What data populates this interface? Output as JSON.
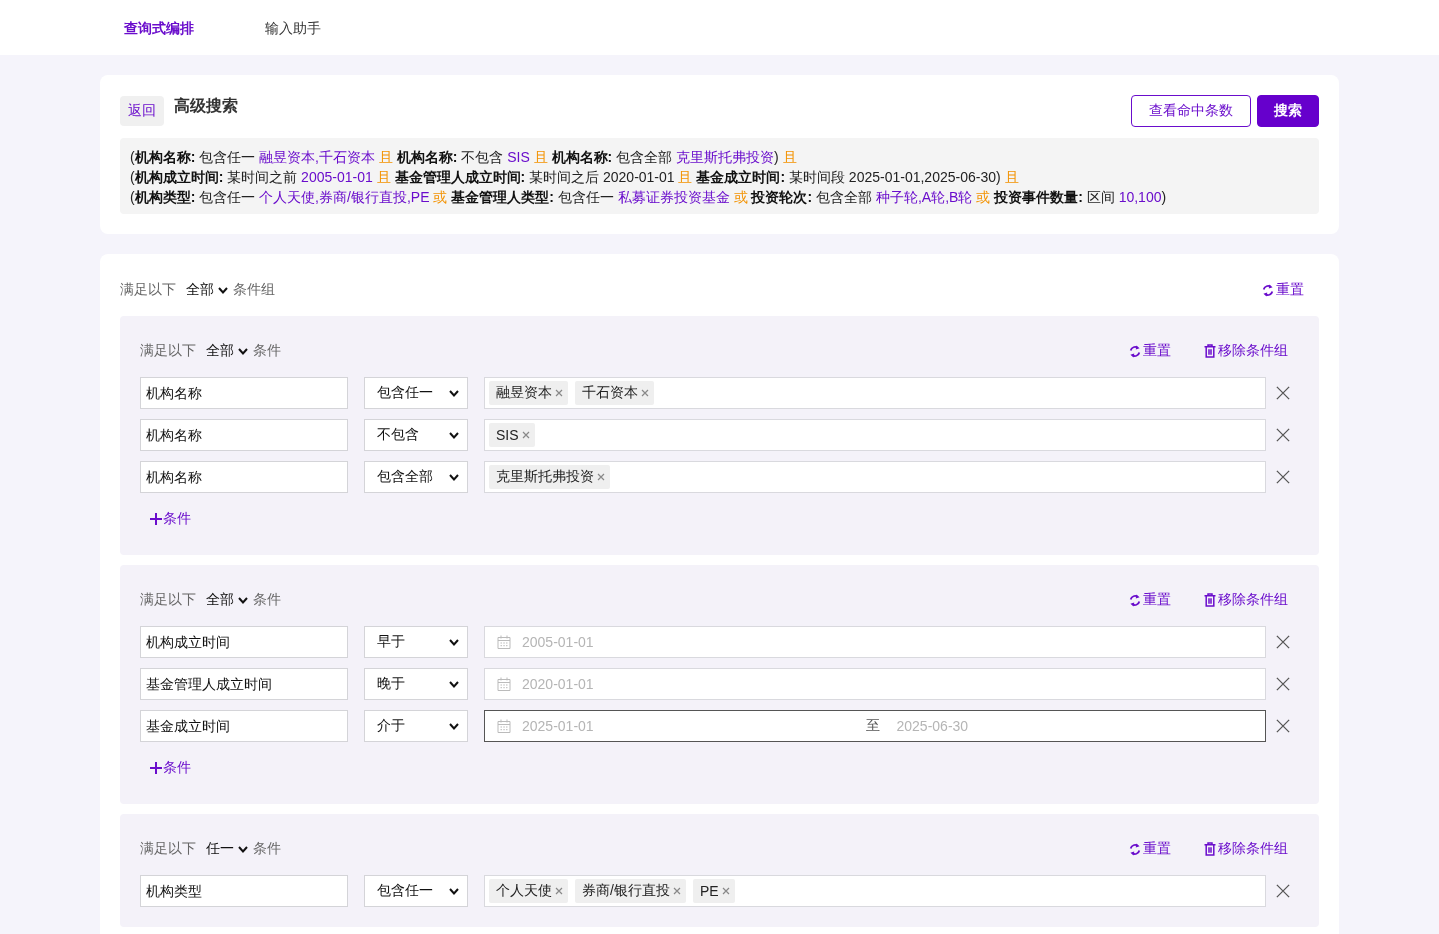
{
  "tabs": [
    {
      "label": "查询式编排",
      "selected": true
    },
    {
      "label": "输入助手",
      "selected": false
    }
  ],
  "header": {
    "back_button": "返回",
    "title": "高级搜索",
    "buttons": [
      {
        "label": "查看命中条数",
        "kind": "outline"
      },
      {
        "label": "搜索",
        "kind": "primary"
      }
    ]
  },
  "summary": {
    "lines": [
      [
        {
          "kind": "open",
          "text": "("
        },
        {
          "kind": "field",
          "text": "机构名称:"
        },
        {
          "kind": "text",
          "text": "包含任一"
        },
        {
          "kind": "value",
          "text": "融昱资本,千石资本"
        },
        {
          "kind": "conj",
          "text": "且"
        },
        {
          "kind": "field",
          "text": "机构名称:"
        },
        {
          "kind": "text",
          "text": "不包含"
        },
        {
          "kind": "value",
          "text": "SIS"
        },
        {
          "kind": "conj",
          "text": "且"
        },
        {
          "kind": "field",
          "text": "机构名称:"
        },
        {
          "kind": "text",
          "text": "包含全部"
        },
        {
          "kind": "value",
          "text": "克里斯托弗投资"
        },
        {
          "kind": "close",
          "text": ")"
        },
        {
          "kind": "conj",
          "text": "且"
        }
      ],
      [
        {
          "kind": "open",
          "text": "("
        },
        {
          "kind": "field",
          "text": "机构成立时间:"
        },
        {
          "kind": "text",
          "text": "某时间之前"
        },
        {
          "kind": "value",
          "text": "2005-01-01"
        },
        {
          "kind": "conj",
          "text": "且"
        },
        {
          "kind": "field",
          "text": "基金管理人成立时间:"
        },
        {
          "kind": "text",
          "text": "某时间之后"
        },
        {
          "kind": "text",
          "text": "2020-01-01"
        },
        {
          "kind": "conj",
          "text": "且"
        },
        {
          "kind": "field",
          "text": "基金成立时间:"
        },
        {
          "kind": "text",
          "text": "某时间段"
        },
        {
          "kind": "text",
          "text": "2025-01-01,2025-06-30"
        },
        {
          "kind": "close",
          "text": ")"
        },
        {
          "kind": "conj",
          "text": "且"
        }
      ],
      [
        {
          "kind": "open",
          "text": "("
        },
        {
          "kind": "field",
          "text": "机构类型:"
        },
        {
          "kind": "text",
          "text": "包含任一"
        },
        {
          "kind": "value",
          "text": "个人天使,券商/银行直投,PE"
        },
        {
          "kind": "conj",
          "text": "或"
        },
        {
          "kind": "field",
          "text": "基金管理人类型:"
        },
        {
          "kind": "text",
          "text": "包含任一"
        },
        {
          "kind": "value",
          "text": "私募证券投资基金"
        },
        {
          "kind": "conj",
          "text": "或"
        },
        {
          "kind": "field",
          "text": "投资轮次:"
        },
        {
          "kind": "text",
          "text": "包含全部"
        },
        {
          "kind": "value",
          "text": "种子轮,A轮,B轮"
        },
        {
          "kind": "conj",
          "text": "或"
        },
        {
          "kind": "field",
          "text": "投资事件数量:"
        },
        {
          "kind": "text",
          "text": "区间"
        },
        {
          "kind": "value",
          "text": "10,100"
        },
        {
          "kind": "close",
          "text": ")"
        }
      ]
    ]
  },
  "condition_root": {
    "prefix": "满足以下",
    "match": "全部",
    "suffix": "条件组",
    "reset": "重置",
    "groups": [
      {
        "prefix": "满足以下",
        "match": "全部",
        "suffix": "条件",
        "reset": "重置",
        "remove": "移除条件组",
        "conditions": [
          {
            "field": "机构名称",
            "operator": "包含任一",
            "kind": "tags",
            "tags": [
              "融昱资本",
              "千石资本"
            ]
          },
          {
            "field": "机构名称",
            "operator": "不包含",
            "kind": "tags",
            "tags": [
              "SIS"
            ]
          },
          {
            "field": "机构名称",
            "operator": "包含全部",
            "kind": "tags",
            "tags": [
              "克里斯托弗投资"
            ]
          }
        ],
        "add": "条件"
      },
      {
        "prefix": "满足以下",
        "match": "全部",
        "suffix": "条件",
        "reset": "重置",
        "remove": "移除条件组",
        "conditions": [
          {
            "field": "机构成立时间",
            "operator": "早于",
            "kind": "date",
            "value": "2005-01-01",
            "focused": false
          },
          {
            "field": "基金管理人成立时间",
            "operator": "晚于",
            "kind": "date",
            "value": "2020-01-01",
            "focused": false
          },
          {
            "field": "基金成立时间",
            "operator": "介于",
            "kind": "date_range",
            "start": "2025-01-01",
            "separator": "至",
            "end": "2025-06-30",
            "focused": true
          }
        ],
        "add": "条件"
      },
      {
        "prefix": "满足以下",
        "match": "任一",
        "suffix": "条件",
        "reset": "重置",
        "remove": "移除条件组",
        "conditions": [
          {
            "field": "机构类型",
            "operator": "包含任一",
            "kind": "tags",
            "tags": [
              "个人天使",
              "券商/银行直投",
              "PE"
            ]
          }
        ]
      }
    ]
  }
}
